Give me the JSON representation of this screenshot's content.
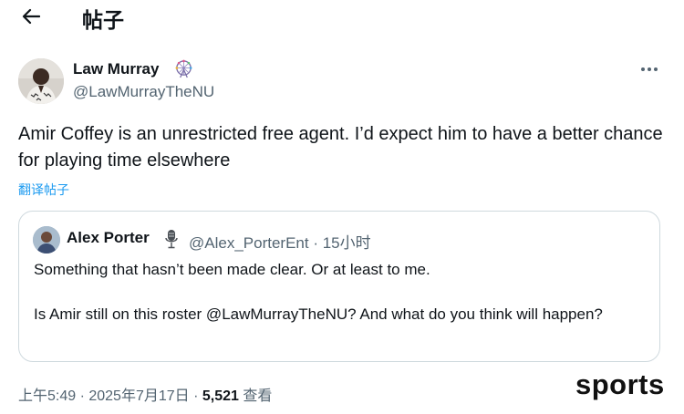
{
  "header": {
    "title": "帖子",
    "back_icon": "arrow-left-icon"
  },
  "author": {
    "name": "Law Murray",
    "handle": "@LawMurrayTheNU",
    "badge_icon": "ferris-wheel-icon",
    "more_icon": "more-dots-icon"
  },
  "tweet": {
    "text": "Amir Coffey is an unrestricted free agent. I’d expect him to have a better chance for playing time elsewhere",
    "translate_label": "翻译帖子"
  },
  "quote": {
    "name": "Alex Porter",
    "badge_icon": "microphone-icon",
    "handle_time": "@Alex_PorterEnt · 15小时",
    "text_line1": "Something that hasn’t been made clear. Or at least to me.",
    "text_line2": "Is Amir still on this roster @LawMurrayTheNU? And what do you think will happen?"
  },
  "meta": {
    "time_date": "上午5:49 · 2025年7月17日 · ",
    "views_count": "5,521",
    "views_label": " 查看"
  },
  "watermark": "sports",
  "colors": {
    "link": "#1d9bf0",
    "secondary_text": "#536471",
    "border": "#cfd9de"
  }
}
